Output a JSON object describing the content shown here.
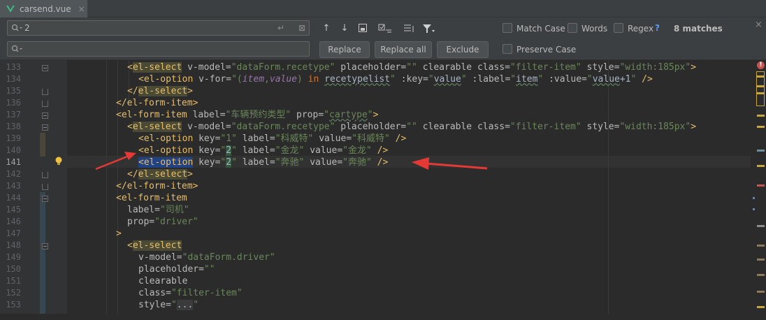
{
  "tab": {
    "filename": "carsend.vue",
    "close": "×"
  },
  "find": {
    "search_value": "2",
    "replace_value": "",
    "match_case_label": "Match Case",
    "words_label": "Words",
    "regex_label": "Regex",
    "regex_help": "?",
    "matches": "8 matches",
    "preserve_case_label": "Preserve Case",
    "replace_button": "Replace",
    "replace_all_button": "Replace all",
    "exclude_button": "Exclude",
    "close": "×"
  },
  "editor": {
    "current_line": "141",
    "lines": [
      {
        "n": "133"
      },
      {
        "n": "134"
      },
      {
        "n": "135"
      },
      {
        "n": "136"
      },
      {
        "n": "137"
      },
      {
        "n": "138"
      },
      {
        "n": "139"
      },
      {
        "n": "140"
      },
      {
        "n": "141"
      },
      {
        "n": "142"
      },
      {
        "n": "143"
      },
      {
        "n": "144"
      },
      {
        "n": "145"
      },
      {
        "n": "146"
      },
      {
        "n": "147"
      },
      {
        "n": "148"
      },
      {
        "n": "149"
      },
      {
        "n": "150"
      },
      {
        "n": "151"
      },
      {
        "n": "152"
      },
      {
        "n": "153"
      }
    ]
  },
  "colors": {
    "background": "#2b2b2b",
    "tag": "#e8bf6a",
    "string": "#6a8759",
    "keyword": "#cc7832",
    "arrow": "#e53935",
    "match_highlight": "#32593d",
    "selection": "#214283"
  },
  "icons": {
    "vue": "vue-icon",
    "search": "search-icon",
    "prev": "arrow-up-icon",
    "next": "arrow-down-icon",
    "error": "error-icon",
    "bulb": "lightbulb-icon"
  }
}
